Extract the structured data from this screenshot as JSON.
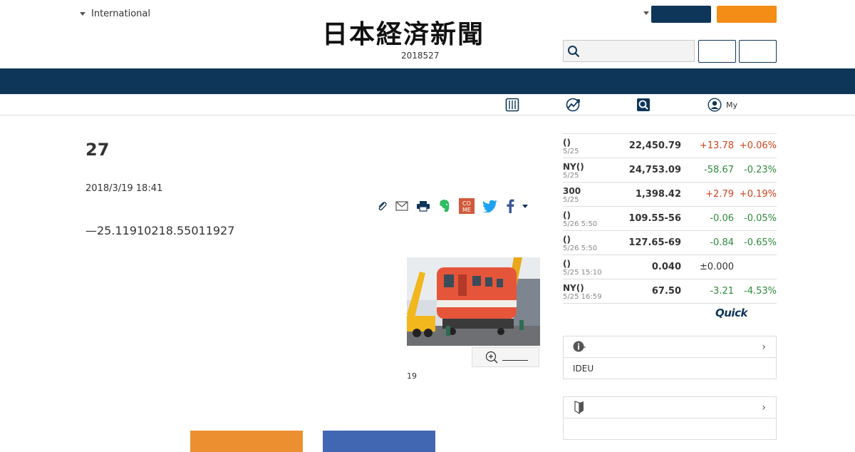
{
  "header": {
    "edition_label": "International",
    "logo_text": "日本経済新聞",
    "date": "2018527"
  },
  "subnav": {
    "items": [
      {
        "label": "",
        "icon": "newspaper-icon"
      },
      {
        "label": "",
        "icon": "chart-icon"
      },
      {
        "label": "",
        "icon": "search-icon"
      },
      {
        "label": "My",
        "icon": "user-icon"
      }
    ]
  },
  "article": {
    "headline": "27",
    "published": "2018/3/19 18:41",
    "lead": "—25.11910218.55011927",
    "photo_caption": "19"
  },
  "market": {
    "rows": [
      {
        "name": "()",
        "time": "5/25",
        "value": "22,450.79",
        "change": "+13.78",
        "pct": "+0.06%",
        "dir": "up"
      },
      {
        "name": "NY()",
        "time": "5/25",
        "value": "24,753.09",
        "change": "-58.67",
        "pct": "-0.23%",
        "dir": "down"
      },
      {
        "name": "300",
        "time": "5/25",
        "value": "1,398.42",
        "change": "+2.79",
        "pct": "+0.19%",
        "dir": "up"
      },
      {
        "name": "()",
        "time": "5/26 5:50",
        "value": "109.55-56",
        "change": "-0.06",
        "pct": "-0.05%",
        "dir": "down"
      },
      {
        "name": "()",
        "time": "5/26 5:50",
        "value": "127.65-69",
        "change": "-0.84",
        "pct": "-0.65%",
        "dir": "down"
      },
      {
        "name": "()",
        "time": "5/25 15:10",
        "value": "0.040",
        "change": "±0.000",
        "pct": "",
        "dir": "flat"
      },
      {
        "name": "NY()",
        "time": "5/25 16:59",
        "value": "67.50",
        "change": "-3.21",
        "pct": "-4.53%",
        "dir": "down"
      }
    ],
    "provider": "Quick"
  },
  "boxes": [
    {
      "icon": "info-icon",
      "body": "IDEU"
    },
    {
      "icon": "beginner-mark-icon",
      "body": ""
    }
  ],
  "colors": {
    "navy": "#0e3659",
    "orange": "#f38d15",
    "up": "#d0421b",
    "down": "#2e8b3a"
  }
}
